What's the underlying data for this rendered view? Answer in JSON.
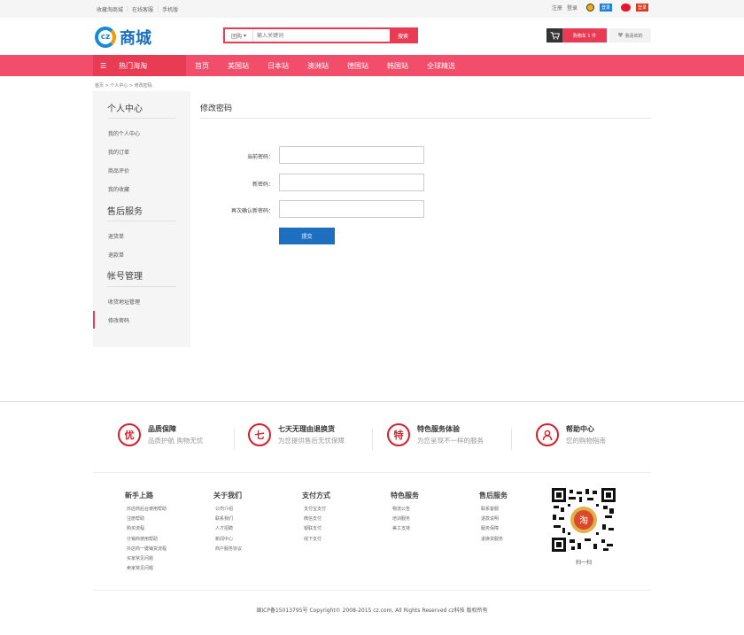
{
  "topbar": {
    "links": [
      "收藏淘商城",
      "在线客服",
      "手机版"
    ],
    "register": "注册",
    "login": "登录",
    "qq_login": "登录",
    "weibo_login": "登录"
  },
  "header": {
    "logo_text": "商城",
    "logo_mark": "cz",
    "search_category": "团购",
    "search_placeholder": "输入关键词",
    "search_button": "搜索",
    "cart_label": "购物车 1 件",
    "favorites_label": "我喜欢的"
  },
  "nav": {
    "all_categories": "热门海淘",
    "items": [
      "首页",
      "美国站",
      "日本站",
      "澳洲站",
      "德国站",
      "韩国站",
      "全球精选"
    ]
  },
  "breadcrumb": "首页 > 个人中心 > 修改密码",
  "sidebar": {
    "sections": [
      {
        "title": "个人中心",
        "items": [
          "我的个人中心",
          "我的订单",
          "商品评价",
          "我的收藏"
        ]
      },
      {
        "title": "售后服务",
        "items": [
          "退货单",
          "退款单"
        ]
      },
      {
        "title": "帐号管理",
        "items": [
          "收货地址管理",
          "修改密码"
        ]
      }
    ]
  },
  "main": {
    "title": "修改密码",
    "fields": [
      {
        "label": "当前密码：",
        "value": ""
      },
      {
        "label": "新密码：",
        "value": ""
      },
      {
        "label": "再次确认新密码：",
        "value": ""
      }
    ],
    "submit": "提交"
  },
  "footer": {
    "services": [
      {
        "icon": "优",
        "title": "品质保障",
        "desc": "品质护航 购物无忧"
      },
      {
        "icon": "七",
        "title": "七天无理由退换货",
        "desc": "为您提供售后无忧保障"
      },
      {
        "icon": "特",
        "title": "特色服务体验",
        "desc": "为您呈现不一样的服务"
      },
      {
        "icon": "person-icon",
        "title": "帮助中心",
        "desc": "您的购物指南"
      }
    ],
    "columns": [
      {
        "title": "新手上路",
        "links": [
          "抖店商后台使用帮助",
          "注册帮助",
          "购买流程",
          "分销商使用帮助",
          "抖店商一键铺货流程",
          "买家常见问题",
          "卖家常见问题"
        ]
      },
      {
        "title": "关于我们",
        "links": [
          "公司介绍",
          "联系我们",
          "人才招聘",
          "新闻中心",
          "商户服务协议"
        ]
      },
      {
        "title": "支付方式",
        "links": [
          "支付宝支付",
          "微信支付",
          "银联支付",
          "线下支付"
        ]
      },
      {
        "title": "特色服务",
        "links": [
          "物流公告",
          "培训服务",
          "美工支持"
        ]
      },
      {
        "title": "售后服务",
        "links": [
          "联系客服",
          "退款说明",
          "服务保障",
          "退换货服务"
        ]
      }
    ],
    "qr_label": "扫一扫",
    "copyright": "闽ICP备15013795号 Copyright© 2008-2015 cz.com, All Rights Reserved cz科技 版权所有"
  }
}
